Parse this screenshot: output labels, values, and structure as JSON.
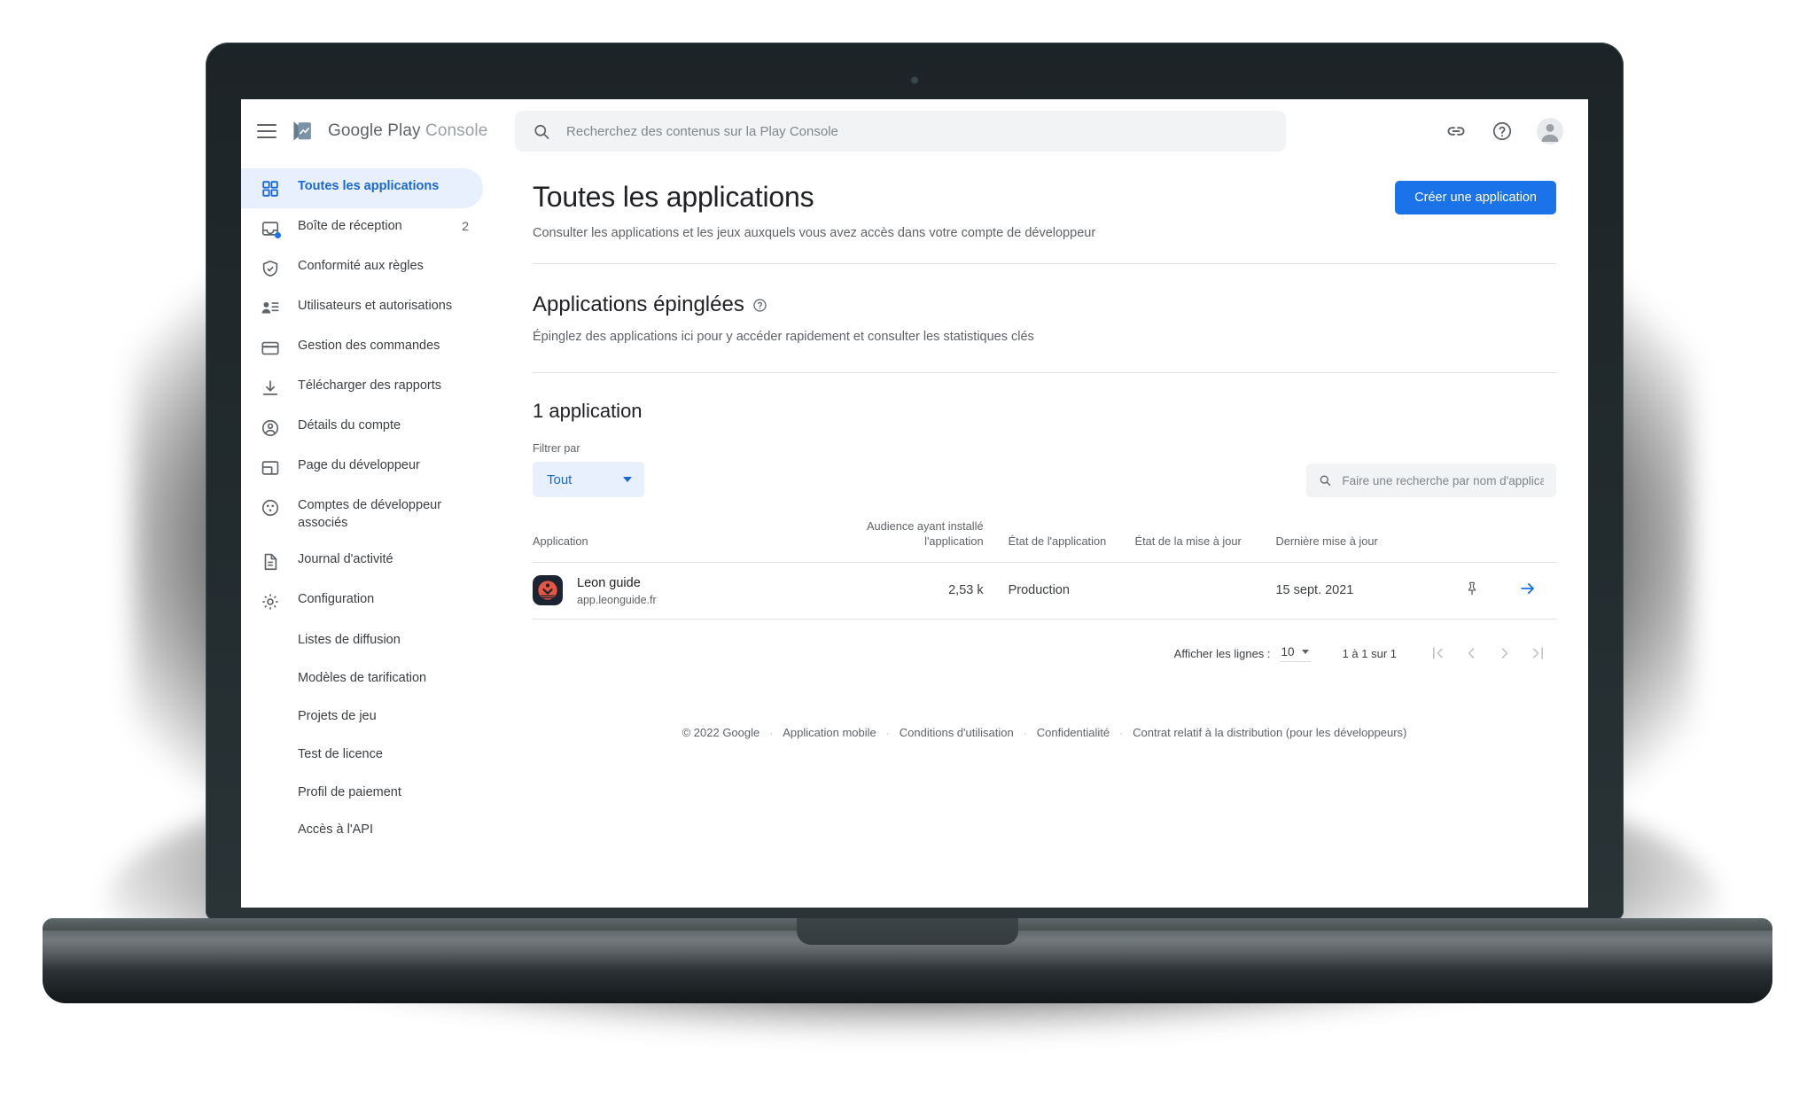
{
  "brand": {
    "name_google_play": "Google Play",
    "name_console": "Console",
    "logo_icon": "google-play-logo"
  },
  "search": {
    "placeholder": "Recherchez des contenus sur la Play Console",
    "value": "",
    "icon": "search-icon"
  },
  "topbar_actions": {
    "link_icon": "link-icon",
    "help_icon": "help-circle-icon",
    "avatar_icon": "account-avatar"
  },
  "sidebar": {
    "items": [
      {
        "label": "Toutes les applications",
        "icon": "grid-apps-icon",
        "active": true,
        "badge": ""
      },
      {
        "label": "Boîte de réception",
        "icon": "inbox-icon",
        "active": false,
        "badge": "2"
      },
      {
        "label": "Conformité aux règles",
        "icon": "shield-check-icon",
        "active": false,
        "badge": ""
      },
      {
        "label": "Utilisateurs et autorisations",
        "icon": "users-permissions-icon",
        "active": false,
        "badge": ""
      },
      {
        "label": "Gestion des commandes",
        "icon": "credit-card-icon",
        "active": false,
        "badge": ""
      },
      {
        "label": "Télécharger des rapports",
        "icon": "download-icon",
        "active": false,
        "badge": ""
      },
      {
        "label": "Détails du compte",
        "icon": "account-circle-icon",
        "active": false,
        "badge": ""
      },
      {
        "label": "Page du développeur",
        "icon": "layout-page-icon",
        "active": false,
        "badge": ""
      },
      {
        "label": "Comptes de développeur associés",
        "icon": "linked-accounts-icon",
        "active": false,
        "badge": ""
      },
      {
        "label": "Journal d'activité",
        "icon": "document-icon",
        "active": false,
        "badge": ""
      },
      {
        "label": "Configuration",
        "icon": "gear-icon",
        "active": false,
        "badge": ""
      }
    ],
    "subitems": [
      {
        "label": "Listes de diffusion"
      },
      {
        "label": "Modèles de tarification"
      },
      {
        "label": "Projets de jeu"
      },
      {
        "label": "Test de licence"
      },
      {
        "label": "Profil de paiement"
      },
      {
        "label": "Accès à l'API"
      }
    ]
  },
  "page": {
    "title": "Toutes les applications",
    "subtitle": "Consulter les applications et les jeux auxquels vous avez accès dans votre compte de développeur",
    "create_button": "Créer une application"
  },
  "pinned": {
    "title": "Applications épinglées",
    "help_icon": "help-circle-icon",
    "subtitle": "Épinglez des applications ici pour y accéder rapidement et consulter les statistiques clés"
  },
  "list": {
    "count_title": "1 application",
    "filter_label": "Filtrer par",
    "filter_value": "Tout",
    "app_search_placeholder": "Faire une recherche par nom d'application...",
    "app_search_value": "",
    "columns": [
      "Application",
      "Audience ayant installé l'application",
      "État de l'application",
      "État de la mise à jour",
      "Dernière mise à jour"
    ],
    "rows": [
      {
        "name": "Leon guide",
        "package": "app.leonguide.fr",
        "audience": "2,53 k",
        "app_state": "Production",
        "update_state": "",
        "last_update": "15 sept. 2021",
        "pin_icon": "pin-icon",
        "go_icon": "arrow-right-icon",
        "icon_bg": "#1c2433",
        "icon_accent": "#e8563f"
      }
    ]
  },
  "pagination": {
    "rows_label": "Afficher les lignes :",
    "rows_value": "10",
    "range": "1 à 1 sur 1",
    "first_icon": "first-page-icon",
    "prev_icon": "chevron-left-icon",
    "next_icon": "chevron-right-icon",
    "last_icon": "last-page-icon"
  },
  "footer": {
    "copyright": "© 2022 Google",
    "links": [
      "Application mobile",
      "Conditions d'utilisation",
      "Confidentialité",
      "Contrat relatif à la distribution (pour les développeurs)"
    ],
    "separator": "·"
  },
  "colors": {
    "accent_blue": "#1a73e8",
    "active_blue_text": "#1967d2",
    "active_blue_bg": "#e8f0fe",
    "text_primary": "#202124",
    "text_secondary": "#5f6368",
    "field_bg": "#f1f3f4",
    "bezel": "#222b2e"
  }
}
